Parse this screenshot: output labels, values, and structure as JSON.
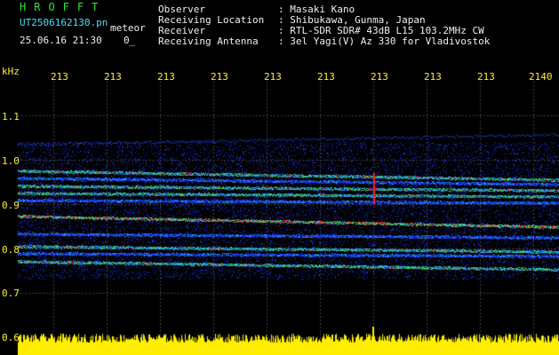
{
  "header": {
    "brand": "HROFFT",
    "filename": "UT2506162130.pn",
    "filename_suffix": "meteor",
    "datetime": "25.06.16 21:30",
    "counter": "0_",
    "info_labels": [
      "Observer",
      "Receiving Location",
      "Receiver",
      "Receiving Antenna"
    ],
    "info_values": [
      ": Masaki Kano",
      ": Shibukawa, Gunma, Japan",
      ": RTL-SDR SDR# 43dB L15 103.2MHz CW",
      ": 3el Yagi(V) Az 330 for Vladivostok"
    ]
  },
  "axes": {
    "y_unit": "kHz",
    "y_ticks": [
      "1.1",
      "1.0",
      "0.9",
      "0.8",
      "0.7",
      "0.6"
    ],
    "x_ticks": [
      "213",
      "213",
      "213",
      "213",
      "213",
      "213",
      "213",
      "213",
      "213",
      "2140"
    ]
  },
  "colors": {
    "background": "#000000",
    "grid": "#404040",
    "info_text": "#2ee62e",
    "axis_text": "#ffee33",
    "signal_strong": "#ff2020",
    "signal_mid": "#30e060",
    "signal_weak": "#2040ff",
    "amplitude": "#ffee00"
  }
}
